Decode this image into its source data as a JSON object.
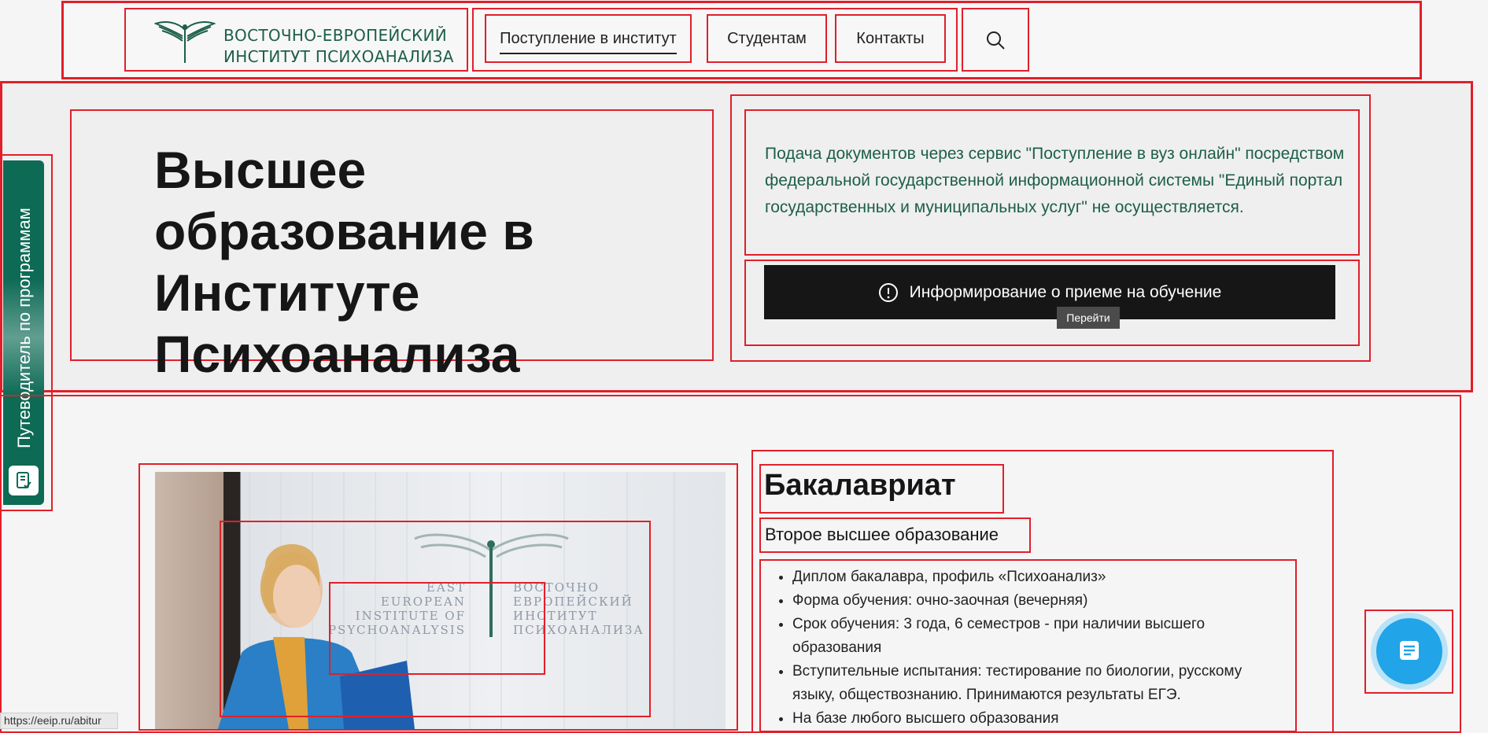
{
  "header": {
    "logo_line1": "ВОСТОЧНО-ЕВРОПЕЙСКИЙ",
    "logo_line2": "ИНСТИТУТ ПСИХОАНАЛИЗА",
    "nav": [
      {
        "label": "Поступление в институт"
      },
      {
        "label": "Студентам"
      },
      {
        "label": "Контакты"
      }
    ],
    "search_icon": "search-icon"
  },
  "hero": {
    "title": "Высшее образование в Институте Психоанализа",
    "notice": "Подача документов через сервис \"Поступление в вуз онлайн\" посредством федеральной государственной информационной системы \"Единый портал государственных и муниципальных услуг\" не осуществляется.",
    "button_label": "Информирование о приеме на обучение",
    "tooltip": "Перейти"
  },
  "side_guide": {
    "label": "Путеводитель по программам"
  },
  "program": {
    "title": "Бакалавриат",
    "subtitle": "Второе высшее образование",
    "items": [
      "Диплом бакалавра, профиль «Психоанализ»",
      "Форма обучения: очно-заочная (вечерняя)",
      "Срок обучения: 3 года, 6 семестров - при наличии высшего образования",
      "Вступительные испытания: тестирование по биологии, русскому языку, обществознанию. Принимаются результаты ЕГЭ.",
      "На базе любого высшего образования"
    ]
  },
  "photo": {
    "sign_en": [
      "EAST",
      "EUROPEAN",
      "INSTITUTE OF",
      "PSYCHOANALYSIS"
    ],
    "sign_ru": [
      "ВОСТОЧНО",
      "ЕВРОПЕЙСКИЙ",
      "ИНСТИТУТ",
      "ПСИХОАНАЛИЗА"
    ]
  },
  "status_url": "https://eeip.ru/abitur",
  "colors": {
    "brand_green": "#1d5e4a",
    "outline_red": "#e11f2a",
    "chat_blue": "#21a4e8"
  }
}
